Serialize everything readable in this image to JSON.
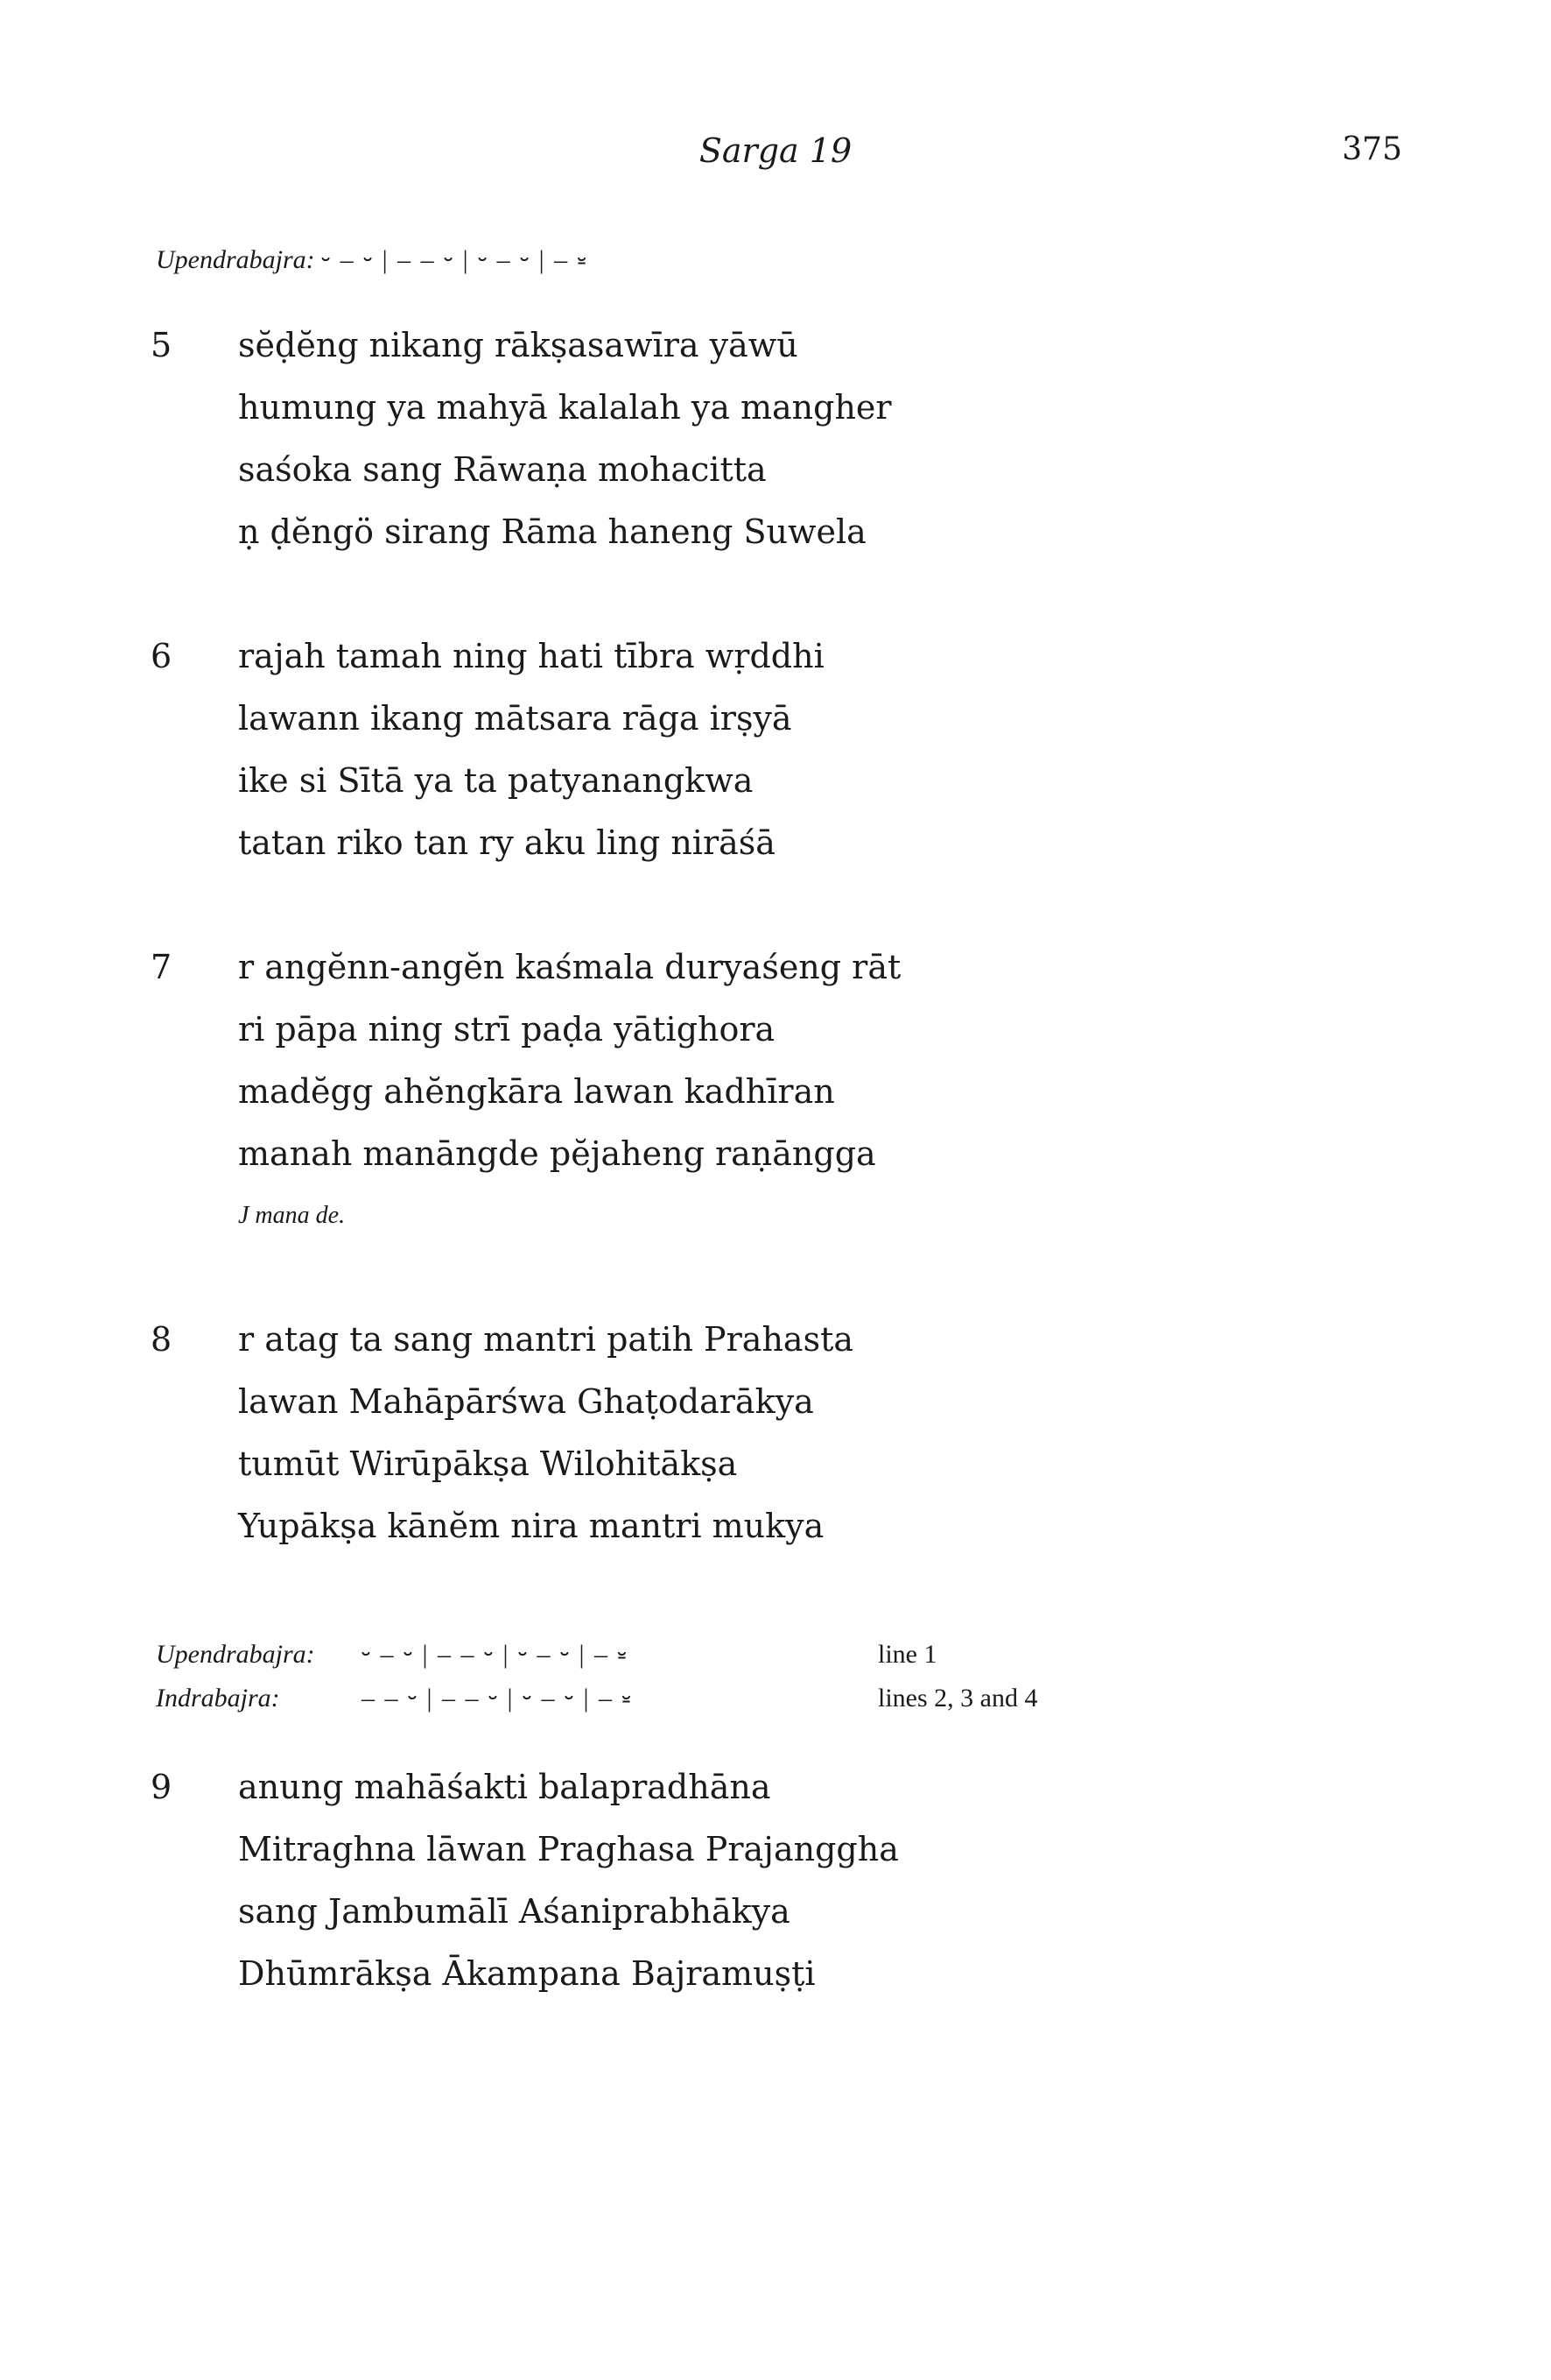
{
  "header": {
    "running_title": "Sarga 19",
    "page_number": "375"
  },
  "meter_heading": {
    "name": "Upendrabajra:",
    "scheme": "⏑ – ⏑ | – – ⏑ | ⏑ – ⏑ | – ⏓"
  },
  "stanzas_first": [
    {
      "number": "5",
      "lines": [
        "sĕḍĕng nikang rākṣasawīra yāwū",
        "humung ya mahyā kalalah ya mangher",
        "saśoka sang Rāwaṇa mohacitta",
        "ṇ ḍĕngö sirang Rāma haneng Suwela"
      ]
    },
    {
      "number": "6",
      "lines": [
        "rajah tamah ning hati tībra wṛddhi",
        "lawann ikang mātsara rāga irṣyā",
        "ike si Sītā ya ta patyanangkwa",
        "tatan riko tan ry aku ling nirāśā"
      ]
    },
    {
      "number": "7",
      "lines": [
        "r angĕnn-angĕn kaśmala duryaśeng rāt",
        "ri pāpa ning strī paḍa yātighora",
        "madĕgg ahĕngkāra lawan kadhīran",
        "manah manāngde pĕjaheng raṇāngga"
      ],
      "footnote": "J mana de."
    },
    {
      "number": "8",
      "lines": [
        "r atag ta sang mantri patih Prahasta",
        "lawan Mahāpārśwa Ghaṭodarākya",
        "tumūt Wirūpākṣa Wilohitākṣa",
        "Yupākṣa kānĕm nira mantri mukya"
      ]
    }
  ],
  "meter_table": [
    {
      "name": "Upendrabajra:",
      "scheme": "⏑ – ⏑ | – – ⏑ | ⏑ – ⏑ | – ⏓",
      "lines": "line 1"
    },
    {
      "name": "Indrabajra:",
      "scheme": "– – ⏑ | – – ⏑ | ⏑ – ⏑ | – ⏓",
      "lines": "lines 2, 3 and 4"
    }
  ],
  "stanzas_second": [
    {
      "number": "9",
      "lines": [
        "anung mahāśakti balapradhāna",
        "Mitraghna lāwan Praghasa Prajanggha",
        "sang Jambumālī Aśaniprabhākya",
        "Dhūmrākṣa Ākampana Bajramuṣṭi"
      ]
    }
  ]
}
